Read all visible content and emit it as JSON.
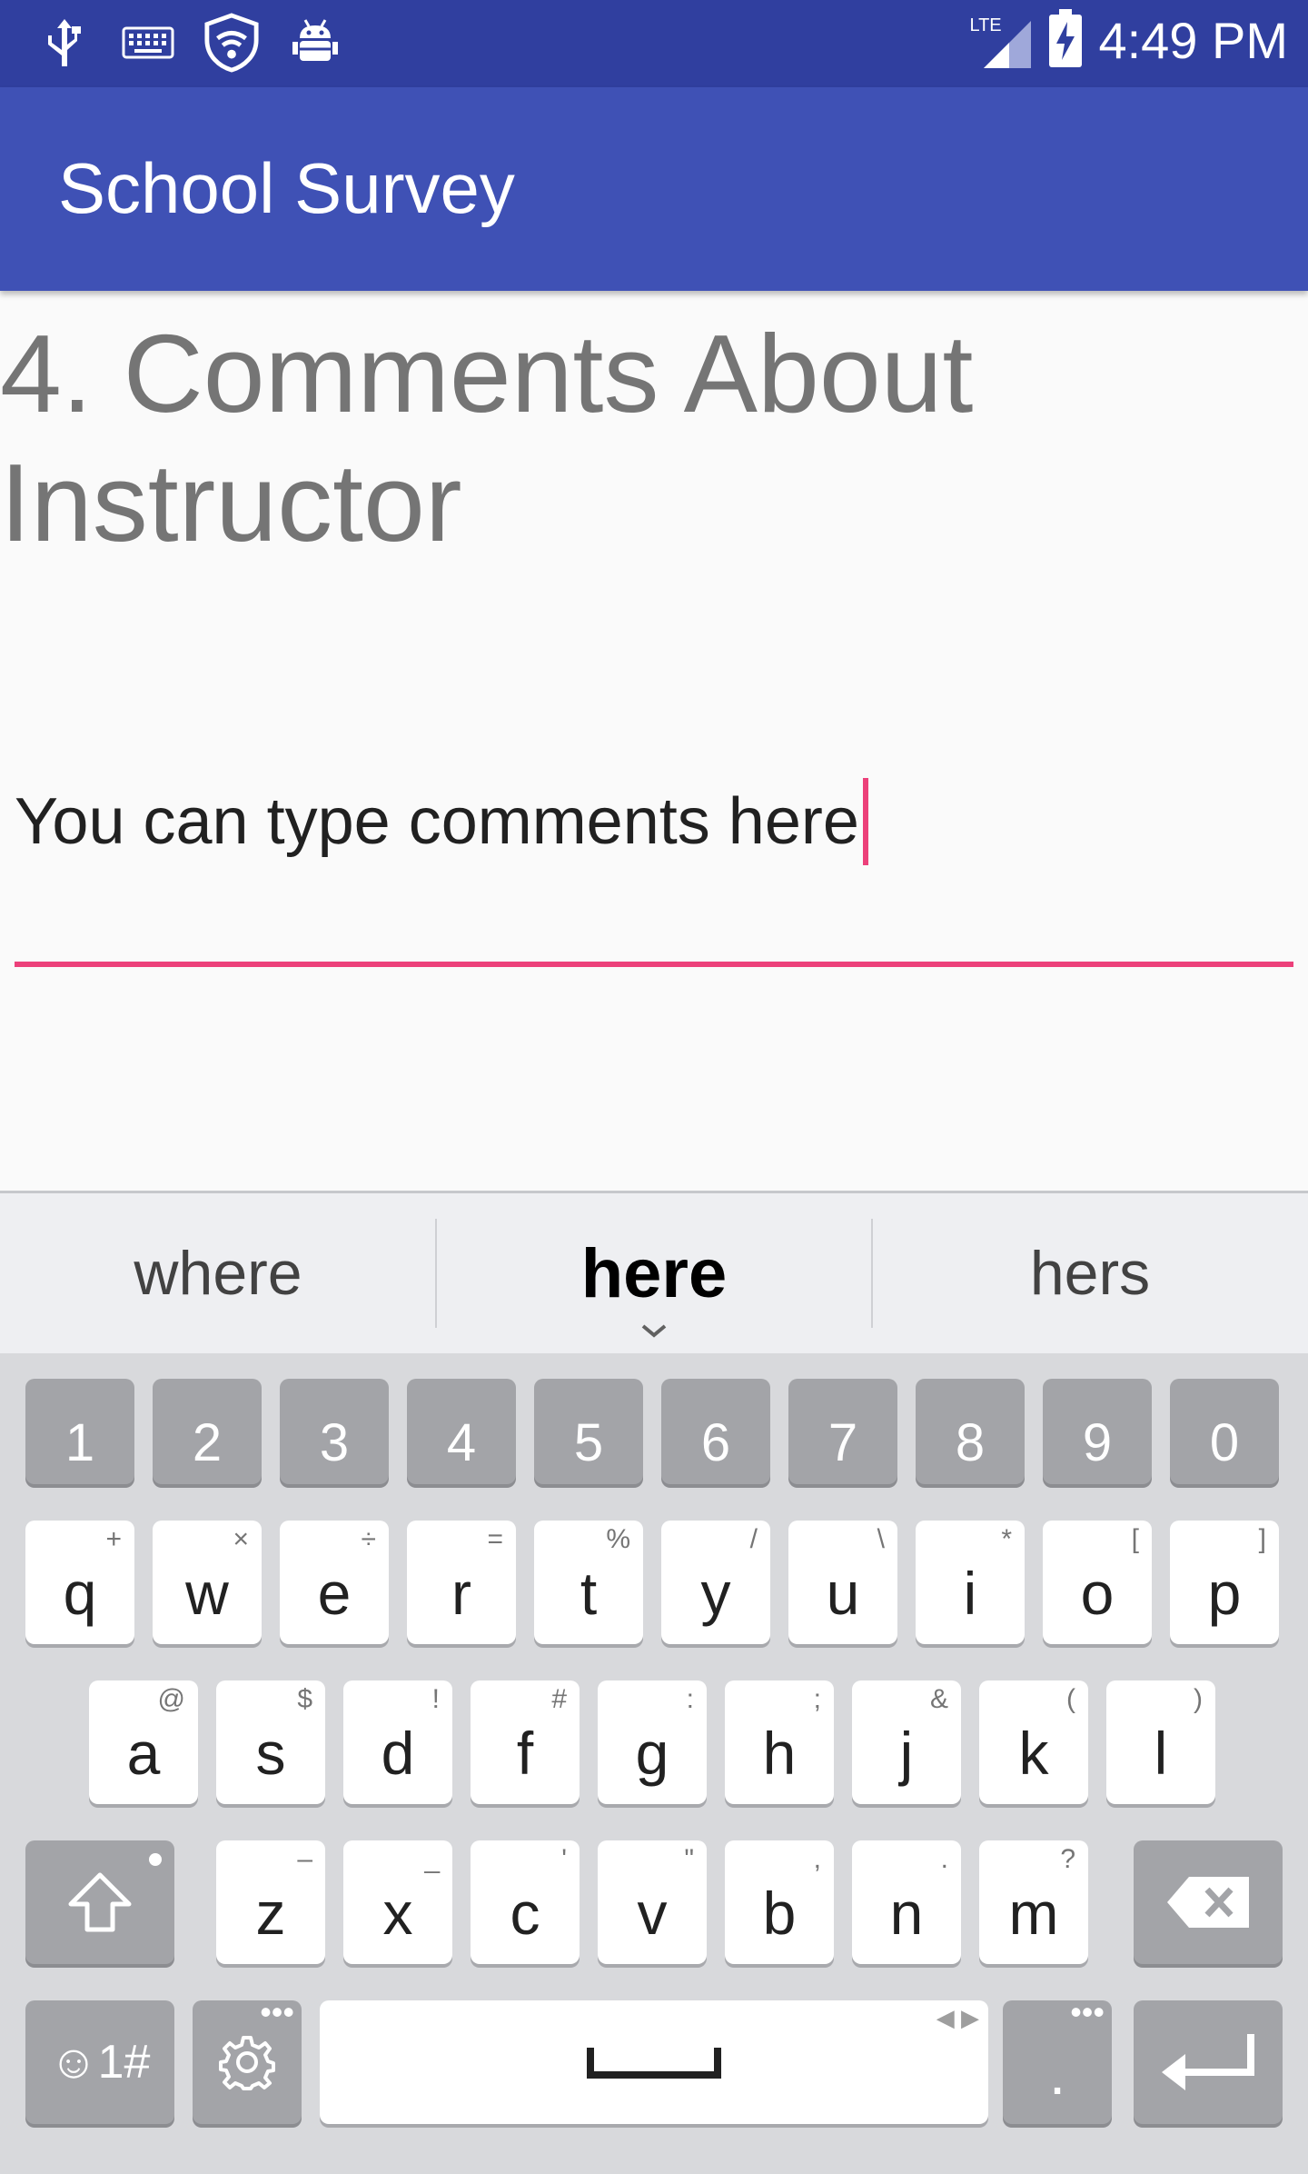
{
  "status_bar": {
    "time": "4:49 PM",
    "network": "LTE",
    "icons": [
      "usb-icon",
      "keyboard-icon",
      "wifi-shield-icon",
      "android-debug-icon"
    ]
  },
  "app_bar": {
    "title": "School Survey"
  },
  "question": {
    "title": "4. Comments About Instructor"
  },
  "comment_input": {
    "value": "You can type comments here"
  },
  "keyboard": {
    "suggestions": [
      "where",
      "here",
      "hers"
    ],
    "number_row": [
      "1",
      "2",
      "3",
      "4",
      "5",
      "6",
      "7",
      "8",
      "9",
      "0"
    ],
    "row1": [
      {
        "key": "q",
        "hint": "+"
      },
      {
        "key": "w",
        "hint": "×"
      },
      {
        "key": "e",
        "hint": "÷"
      },
      {
        "key": "r",
        "hint": "="
      },
      {
        "key": "t",
        "hint": "%"
      },
      {
        "key": "y",
        "hint": "/"
      },
      {
        "key": "u",
        "hint": "\\"
      },
      {
        "key": "i",
        "hint": "*"
      },
      {
        "key": "o",
        "hint": "["
      },
      {
        "key": "p",
        "hint": "]"
      }
    ],
    "row2": [
      {
        "key": "a",
        "hint": "@"
      },
      {
        "key": "s",
        "hint": "$"
      },
      {
        "key": "d",
        "hint": "!"
      },
      {
        "key": "f",
        "hint": "#"
      },
      {
        "key": "g",
        "hint": ":"
      },
      {
        "key": "h",
        "hint": ";"
      },
      {
        "key": "j",
        "hint": "&"
      },
      {
        "key": "k",
        "hint": "("
      },
      {
        "key": "l",
        "hint": ")"
      }
    ],
    "row3": [
      {
        "key": "z",
        "hint": "–"
      },
      {
        "key": "x",
        "hint": "_"
      },
      {
        "key": "c",
        "hint": "'"
      },
      {
        "key": "v",
        "hint": "\""
      },
      {
        "key": "b",
        "hint": ","
      },
      {
        "key": "n",
        "hint": "."
      },
      {
        "key": "m",
        "hint": "?"
      }
    ],
    "symbols_key": "☺1#",
    "period_key": "."
  }
}
